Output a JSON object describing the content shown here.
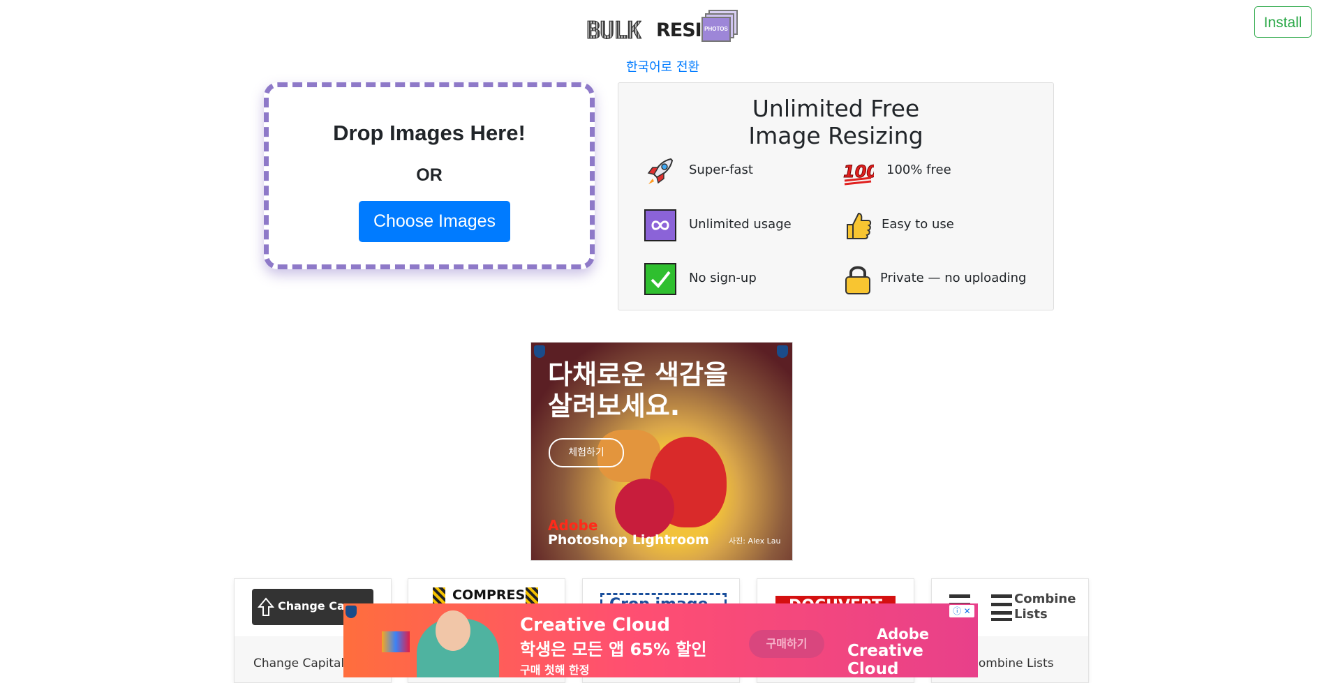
{
  "header": {
    "logo_word1": "BULK",
    "logo_word2": "RESIZE",
    "logo_badge": "PHOTOS",
    "install_label": "Install",
    "lang_link": "한국어로 전환"
  },
  "dropzone": {
    "title": "Drop Images Here!",
    "or_label": "OR",
    "choose_label": "Choose Images"
  },
  "features": {
    "title": "Unlimited Free Image Resizing",
    "items": [
      {
        "icon": "rocket-icon",
        "label": "Super-fast"
      },
      {
        "icon": "hundred-points-icon",
        "label": "100% free"
      },
      {
        "icon": "infinity-icon",
        "label": "Unlimited usage"
      },
      {
        "icon": "thumbs-up-icon",
        "label": "Easy to use"
      },
      {
        "icon": "check-mark-icon",
        "label": "No sign-up"
      },
      {
        "icon": "lock-icon",
        "label": "Private — no uploading"
      }
    ]
  },
  "ad_square": {
    "headline_line1": "다채로운 색감을",
    "headline_line2": "살려보세요.",
    "cta": "체험하기",
    "brand": "Adobe",
    "product": "Photoshop Lightroom",
    "credit": "사진: Alex Lau"
  },
  "tools": [
    {
      "banner": "Change Case",
      "caption": "Change Capitaliz"
    },
    {
      "banner": "COMPRESS",
      "caption": ""
    },
    {
      "banner": "Crop image",
      "caption": ""
    },
    {
      "banner": "DOCUVERT",
      "caption": ""
    },
    {
      "banner": "Combine Lists",
      "caption": "Combine Lists"
    }
  ],
  "ad_banner": {
    "title": "Creative Cloud",
    "line2": "학생은 모든 앱 65% 할인",
    "line3": "구매 첫해 한정",
    "cta": "구매하기",
    "logo_brand": "Adobe",
    "logo_product": "Creative Cloud",
    "info_label": "ⓘ ✕"
  },
  "colors": {
    "accent_blue": "#007bff",
    "install_green": "#28a745",
    "dropzone_border": "#8e79c8"
  }
}
